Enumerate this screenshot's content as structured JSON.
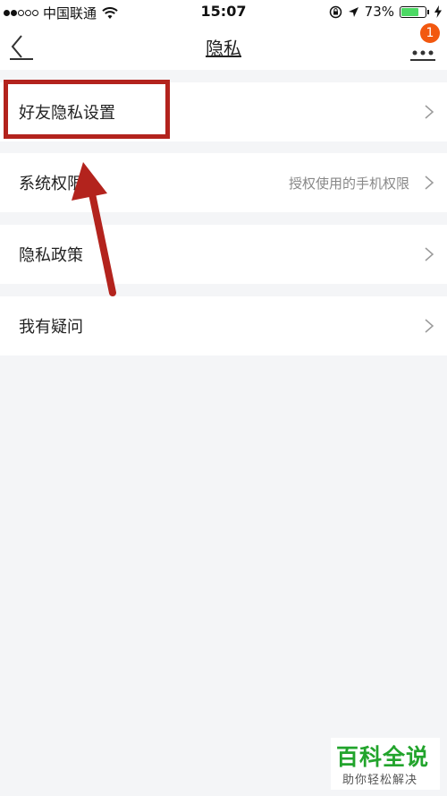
{
  "status_bar": {
    "carrier": "中国联通",
    "time": "15:07",
    "battery_percent": "73%",
    "battery_level": 0.73
  },
  "nav": {
    "title": "隐私",
    "badge_count": "1"
  },
  "items": [
    {
      "label": "好友隐私设置",
      "value": ""
    },
    {
      "label": "系统权限",
      "value": "授权使用的手机权限"
    },
    {
      "label": "隐私政策",
      "value": ""
    },
    {
      "label": "我有疑问",
      "value": ""
    }
  ],
  "annotation": {
    "color": "#b3231d"
  },
  "watermark": {
    "title": "百科全说",
    "subtitle": "助你轻松解决"
  },
  "colors": {
    "background": "#f4f5f7",
    "badge": "#f2580f",
    "battery": "#4cd964",
    "watermark": "#22a42c"
  }
}
